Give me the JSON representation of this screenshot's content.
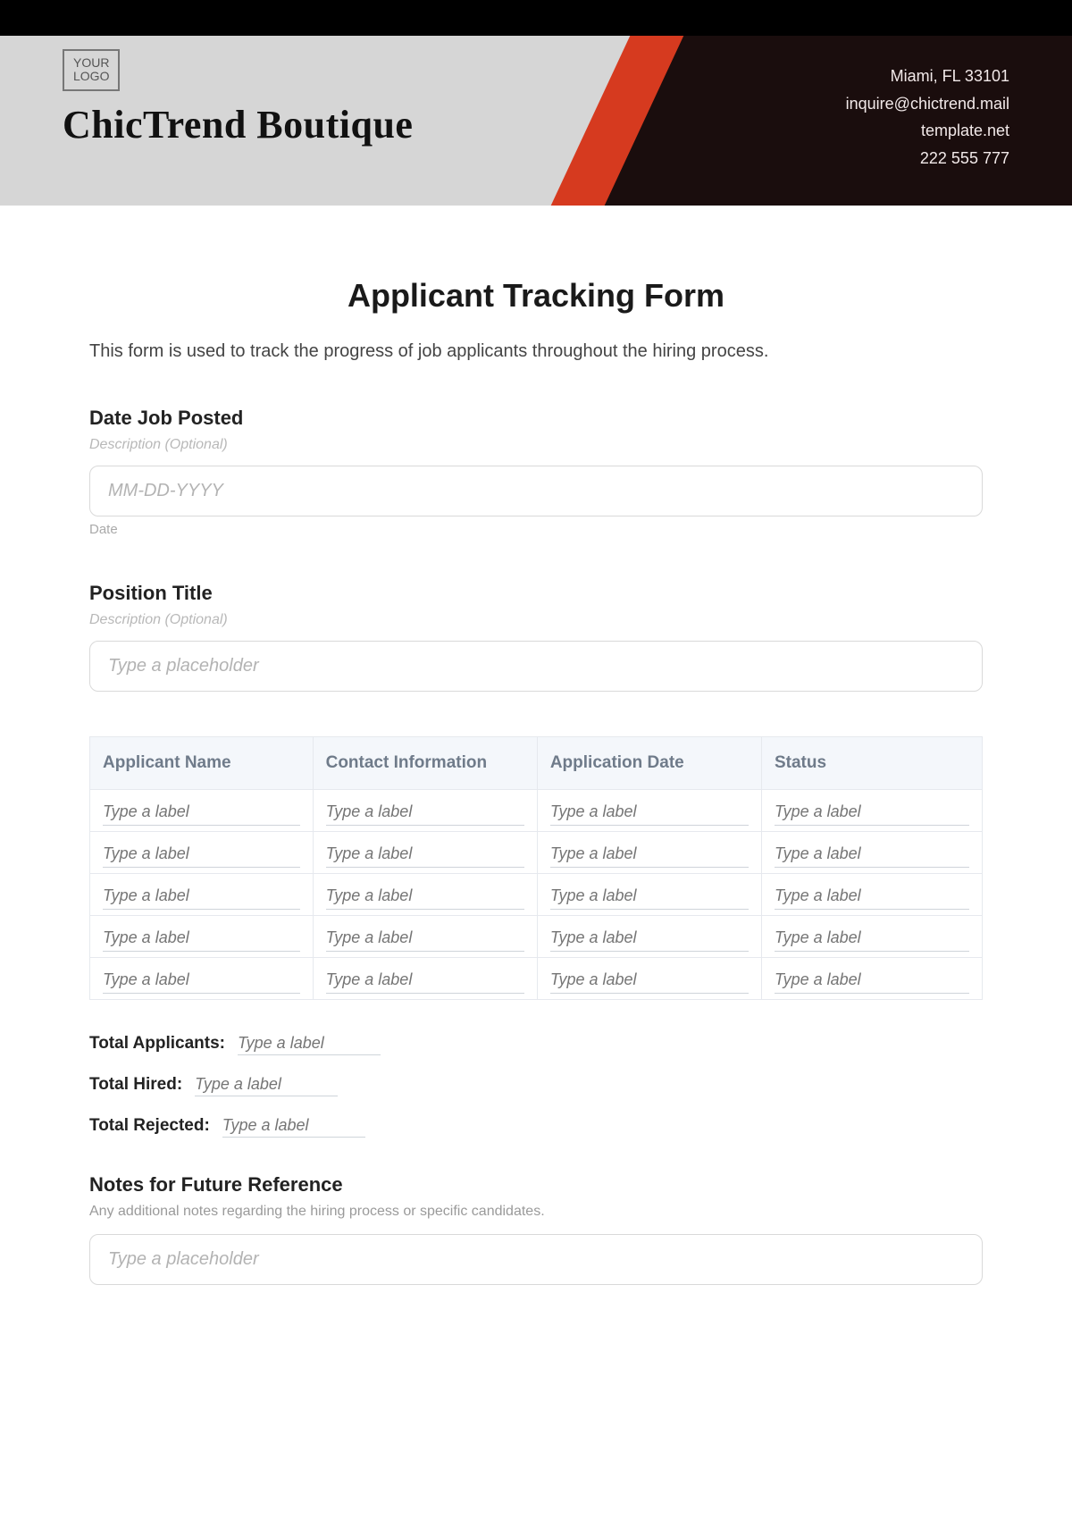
{
  "header": {
    "logo_text": "YOUR\nLOGO",
    "company_name": "ChicTrend Boutique",
    "contact": {
      "city": "Miami, FL 33101",
      "email": "inquire@chictrend.mail",
      "site": "template.net",
      "phone": "222 555 777"
    }
  },
  "form": {
    "title": "Applicant Tracking Form",
    "description": "This form is used to track the progress of job applicants throughout the hiring process.",
    "date_posted": {
      "label": "Date Job Posted",
      "sub": "Description (Optional)",
      "placeholder": "MM-DD-YYYY",
      "hint": "Date"
    },
    "position_title": {
      "label": "Position Title",
      "sub": "Description (Optional)",
      "placeholder": "Type a placeholder"
    },
    "table": {
      "headers": [
        "Applicant Name",
        "Contact Information",
        "Application Date",
        "Status"
      ],
      "cell_placeholder": "Type a label",
      "row_count": 5
    },
    "summary": {
      "total_applicants_label": "Total Applicants:",
      "total_hired_label": "Total Hired:",
      "total_rejected_label": "Total Rejected:",
      "placeholder": "Type a label"
    },
    "notes": {
      "title": "Notes for Future Reference",
      "sub": "Any additional notes regarding the hiring process or specific candidates.",
      "placeholder": "Type a placeholder"
    }
  }
}
